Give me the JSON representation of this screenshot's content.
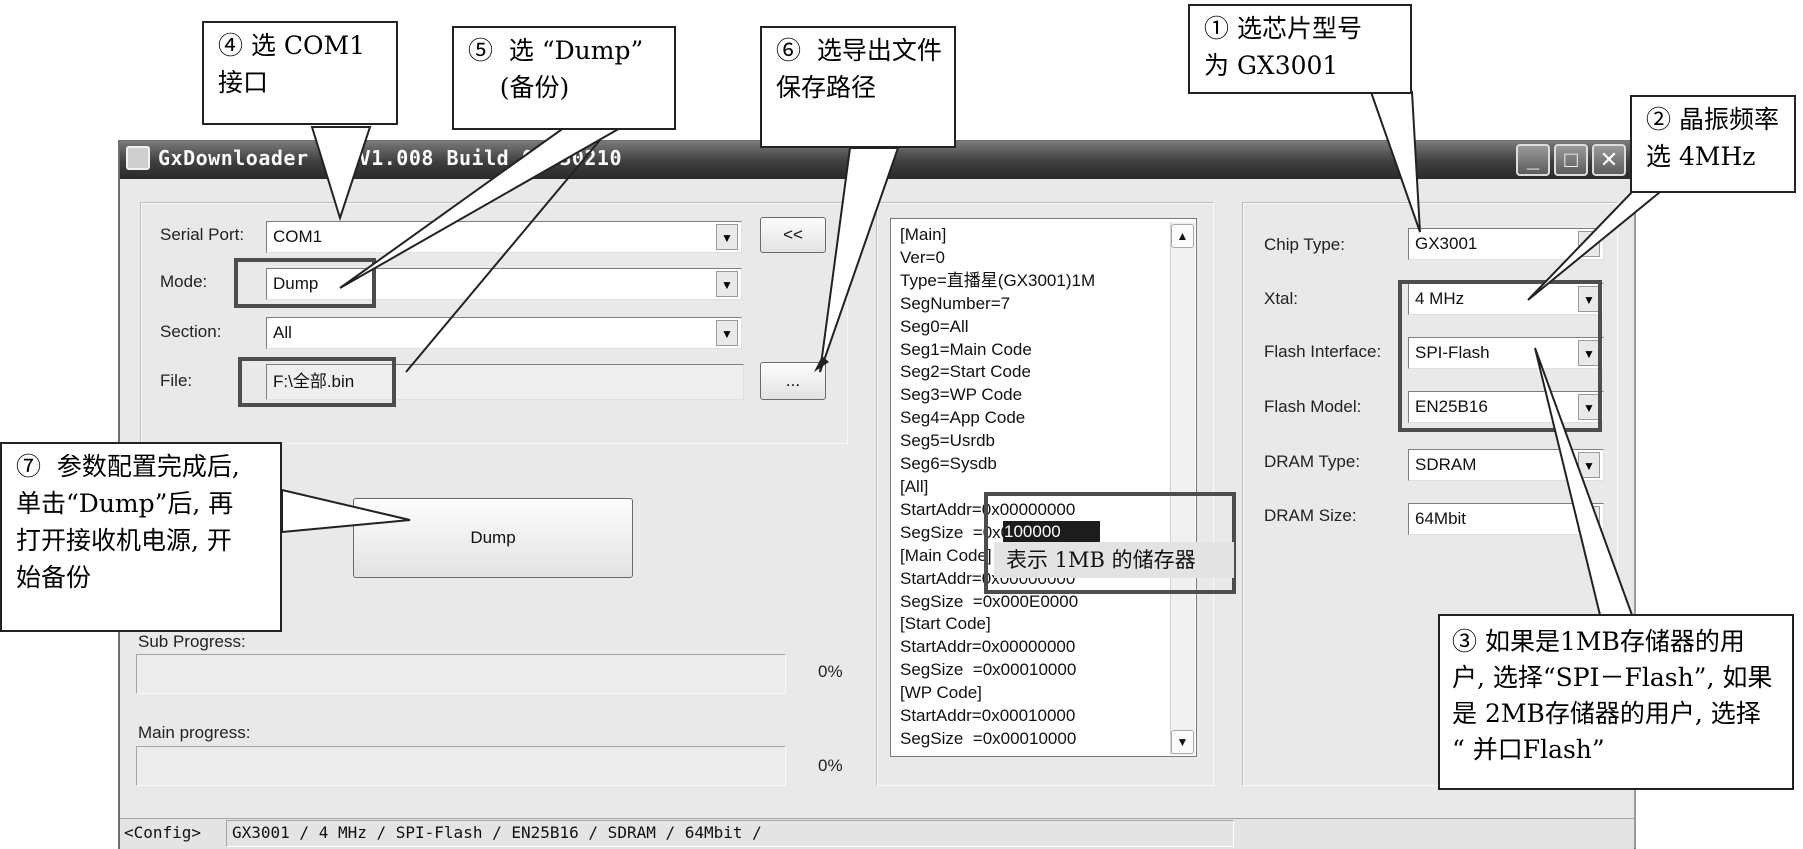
{
  "window": {
    "title": "GxDownloader UI V1.008 Build 09030210",
    "min_label": "_",
    "max_label": "□",
    "close_label": "✕"
  },
  "form": {
    "serial_port": {
      "label": "Serial Port:",
      "value": "COM1"
    },
    "mode": {
      "label": "Mode:",
      "value": "Dump"
    },
    "section": {
      "label": "Section:",
      "value": "All"
    },
    "file": {
      "label": "File:",
      "value": "F:\\全部.bin"
    },
    "collapse_button": "<<",
    "browse_button": "...",
    "dump_button": "Dump"
  },
  "progress": {
    "sub": {
      "label": "Sub Progress:",
      "value_text": "0%",
      "fraction": 0
    },
    "main": {
      "label": "Main progress:",
      "value_text": "0%",
      "fraction": 0
    }
  },
  "list": {
    "lines": [
      "[Main]",
      "Ver=0",
      "Type=直播星(GX3001)1M",
      "SegNumber=7",
      "Seg0=All",
      "Seg1=Main Code",
      "Seg2=Start Code",
      "Seg3=WP Code",
      "Seg4=App Code",
      "Seg5=Usrdb",
      "Seg6=Sysdb",
      "[All]",
      "StartAddr=0x00000000",
      "SegSize  =0x00100000",
      "[Main Code]",
      "StartAddr=0x00000000",
      "SegSize  =0x000E0000",
      "[Start Code]",
      "StartAddr=0x00000000",
      "SegSize  =0x00010000",
      "[WP Code]",
      "StartAddr=0x00010000",
      "SegSize  =0x00010000"
    ],
    "scroll_up": "▲",
    "scroll_down": "▼"
  },
  "chip": {
    "chip_type": {
      "label": "Chip Type:",
      "value": "GX3001"
    },
    "xtal": {
      "label": "Xtal:",
      "value": "4 MHz"
    },
    "flash_interface": {
      "label": "Flash Interface:",
      "value": "SPI-Flash"
    },
    "flash_model": {
      "label": "Flash Model:",
      "value": "EN25B16"
    },
    "dram_type": {
      "label": "DRAM Type:",
      "value": "SDRAM"
    },
    "dram_size": {
      "label": "DRAM Size:",
      "value": "64Mbit"
    }
  },
  "status": {
    "tag": "<Config>",
    "text": "GX3001 / 4 MHz / SPI-Flash / EN25B16 / SDRAM / 64Mbit /"
  },
  "annotations": {
    "c1": "① 选芯片型号\n为 GX3001",
    "c2": "② 晶振频率\n选 4MHz",
    "c3": "③ 如果是1MB存储器的用\n户, 选择“SPI－Flash”, 如果\n是 2MB存储器的用户, 选择\n“ 并口Flash”",
    "c4": "④ 选 COM1\n接口",
    "c5": "⑤  选 “Dump”\n    (备份)",
    "c6": "⑥  选导出文件\n保存路径",
    "c7": "⑦  参数配置完成后,\n单击“Dump”后, 再\n打开接收机电源, 开\n始备份",
    "segsize_note": "表示 1MB 的储存器"
  },
  "colors": {
    "window_bg": "#e9e9e9",
    "titlebar": "#3e3e3e",
    "highlight_box": "#4d4d4d",
    "selection": "#1a1a1a"
  }
}
